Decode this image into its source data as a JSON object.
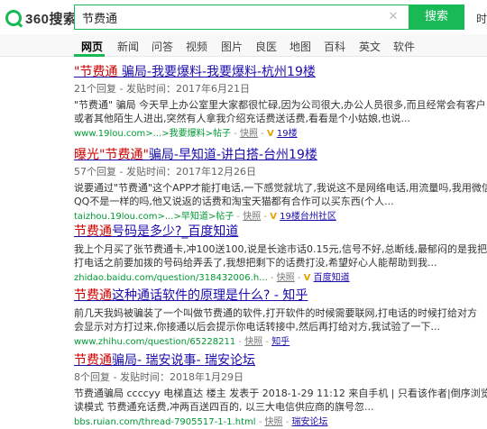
{
  "header": {
    "logo_text": "360搜索",
    "query": "节费通",
    "clear_glyph": "✕",
    "search_button": "搜索",
    "right_link": "时"
  },
  "nav": [
    {
      "label": "网页",
      "active": true
    },
    {
      "label": "新闻"
    },
    {
      "label": "问答"
    },
    {
      "label": "视频"
    },
    {
      "label": "图片"
    },
    {
      "label": "良医"
    },
    {
      "label": "地图"
    },
    {
      "label": "百科"
    },
    {
      "label": "英文"
    },
    {
      "label": "软件"
    }
  ],
  "results": [
    {
      "title_hl": "\"节费通 ",
      "title_rest": "骗局-我要爆料-我要爆料-杭州19楼",
      "meta": "21个回复 - 发贴时间：2017年6月21日",
      "snippet": [
        "\"节费通\" 骗局 今天早上办公室里大家都很忙碌,因为公司很大,办公人员很多,而且经常会有客户",
        "或者其他陌生人进出,突然有人拿我介绍充话费送话费,看看是个小姑娘,也说..."
      ],
      "url": "www.19lou.com>...>我要爆料>帖子",
      "snapshot": "快照",
      "badge": "V",
      "source": "19楼"
    },
    {
      "title_hl": "曝光\"节费通\"",
      "title_rest": "骗局-早知道-讲白搭-台州19楼",
      "meta": "57个回复 - 发贴时间：2017年12月26日",
      "snippet": [
        "说要通过\"节费通\"这个APP才能打电话,一下感觉就坑了,我说这不是网络电话,用流量吗,我用微信",
        "QQ不是一样的吗,他又说返的话费和淘宝天猫都有合作可以买东西(个人..."
      ],
      "url": "taizhou.19lou.com>...>早知道>帖子",
      "snapshot": "快照",
      "badge": "V",
      "source": "19楼台州社区"
    },
    {
      "title_hl": "节费通",
      "title_rest": "号码是多少?_百度知道",
      "meta": "",
      "snippet": [
        "我上个月买了张节费通卡,冲100送100,说是长途市话0.15元,信号不好,总断线,最郁闷的是我把",
        "打电话之前要加拨的号码给弄丢了,我想把剩下的话费打没,希望好心人能帮助到我..."
      ],
      "url": "zhidao.baidu.com/question/318432006.h...",
      "snapshot": "快照",
      "badge": "V",
      "source": "百度知道"
    },
    {
      "title_hl": "节费通",
      "title_rest": "这种通话软件的原理是什么? - 知乎",
      "meta": "",
      "snippet": [
        "前几天我妈被骗装了一个叫做节费通的软件,打开软件的时候需要联网,打电话的时候打给对方",
        "会显示对方打过来,你接通以后会提示你电话转接中,然后再打给对方,我试验了一下..."
      ],
      "url": "www.zhihu.com/question/65228211",
      "snapshot": "快照",
      "badge": "",
      "source": "知乎"
    },
    {
      "title_hl": "节费通",
      "title_rest": "骗局- 瑞安说事- 瑞安论坛",
      "meta": "8个回复 - 发贴时间：2018年1月29日",
      "snippet": [
        "节费通骗局 ccccyy 电梯直达 楼主 发表于 2018-1-29 11:12 来自手机 | 只看该作者|倒序浏览|阅",
        "读模式 节费通充话费,冲两百送四百的, 以三大电信供应商的旗号忽..."
      ],
      "url": "bbs.ruian.com/thread-7905517-1-1.html",
      "snapshot": "快照",
      "badge": "",
      "source": "瑞安论坛"
    }
  ]
}
